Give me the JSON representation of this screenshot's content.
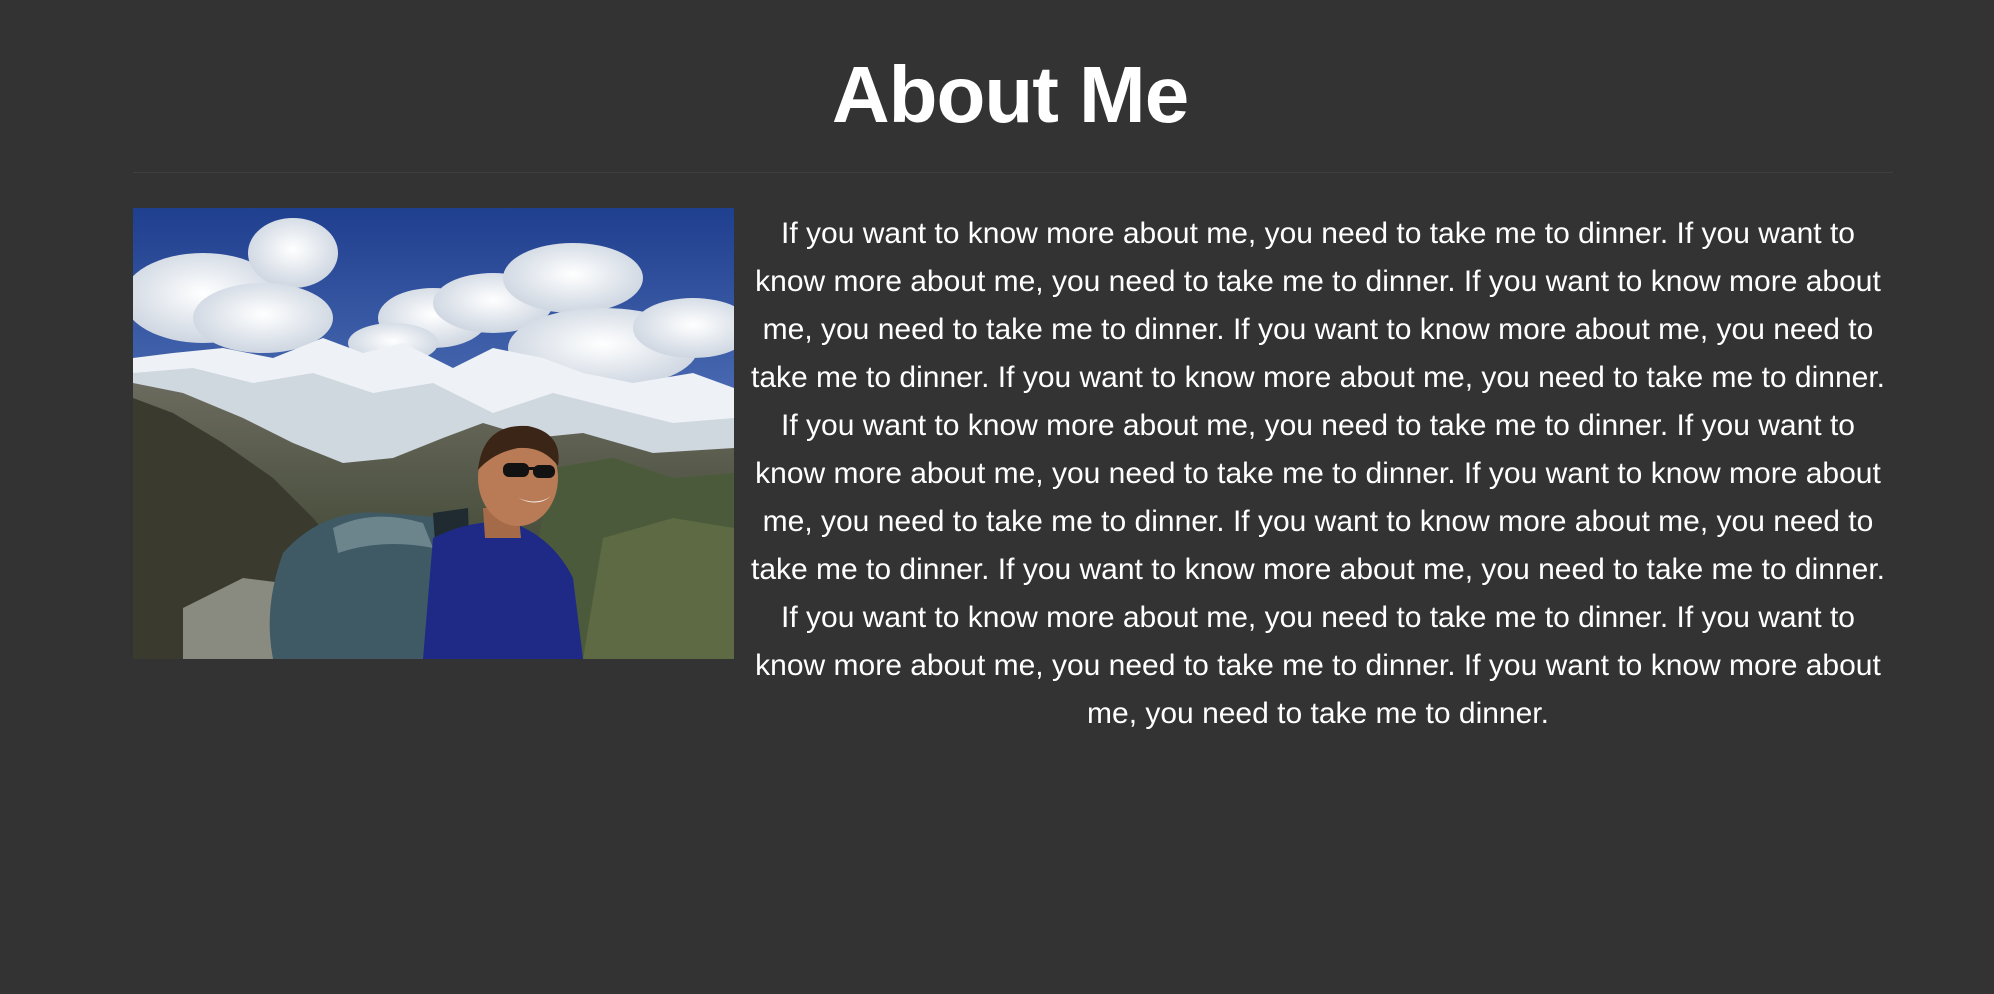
{
  "page": {
    "title": "About Me",
    "bio": "If you want to know more about me, you need to take me to dinner. If you want to know more about me, you need to take me to dinner. If you want to know more about me, you need to take me to dinner. If you want to know more about me, you need to take me to dinner. If you want to know more about me, you need to take me to dinner. If you want to know more about me, you need to take me to dinner. If you want to know more about me, you need to take me to dinner. If you want to know more about me, you need to take me to dinner. If you want to know more about me, you need to take me to dinner. If you want to know more about me, you need to take me to dinner. If you want to know more about me, you need to take me to dinner. If you want to know more about me, you need to take me to dinner. If you want to know more about me, you need to take me to dinner."
  },
  "colors": {
    "background": "#333333",
    "text": "#ffffff",
    "divider": "#3f3f3f"
  }
}
